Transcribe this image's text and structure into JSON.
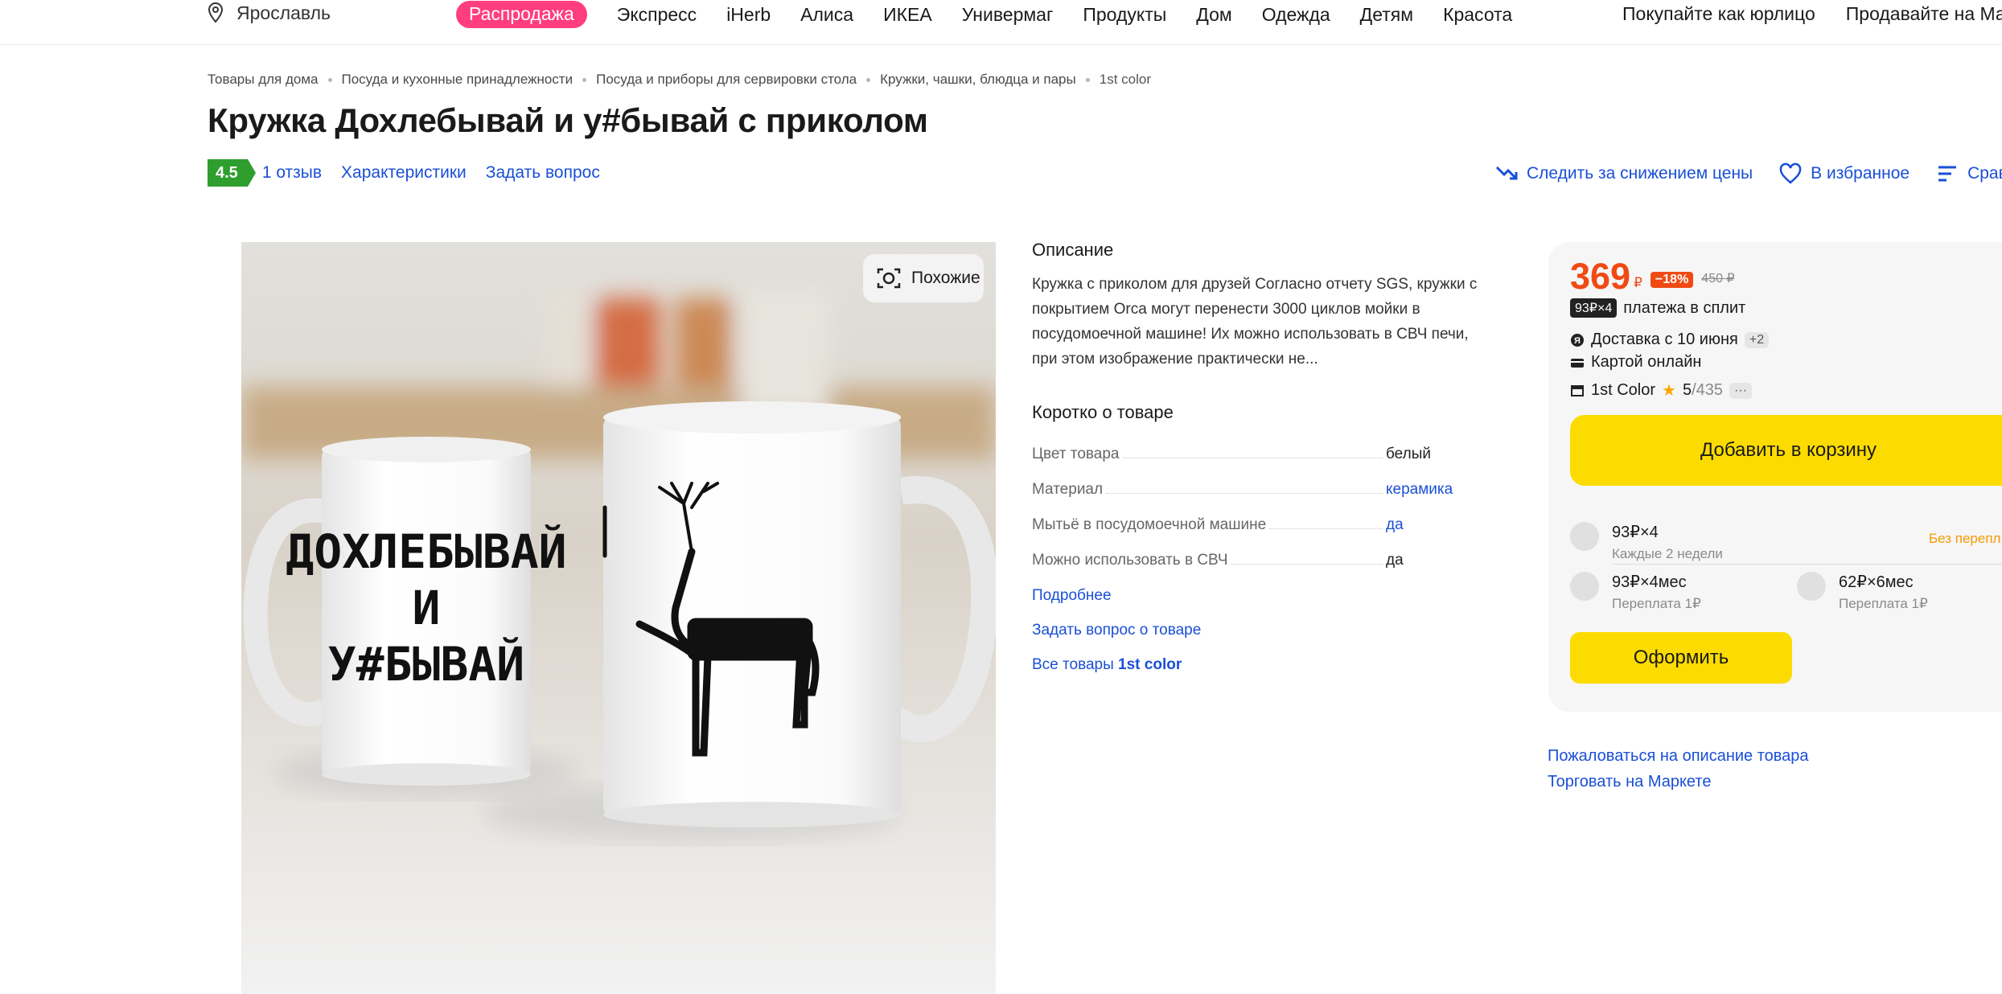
{
  "nav": {
    "location": "Ярославль",
    "sale": "Распродажа",
    "items": [
      "Экспресс",
      "iHerb",
      "Алиса",
      "ИКЕА",
      "Универмаг",
      "Продукты",
      "Дом",
      "Одежда",
      "Детям",
      "Красота"
    ],
    "right": [
      "Покупайте как юрлицо",
      "Продавайте на Мар"
    ]
  },
  "breadcrumb": [
    "Товары для дома",
    "Посуда и кухонные принадлежности",
    "Посуда и приборы для сервировки стола",
    "Кружки, чашки, блюдца и пары",
    "1st color"
  ],
  "product": {
    "title": "Кружка Дохлебывай и у#бывай с приколом",
    "rating": "4.5",
    "reviews": "1 отзыв",
    "specs_link": "Характеристики",
    "ask_link": "Задать вопрос"
  },
  "actions": {
    "price_watch": "Следить за снижением цены",
    "favorite": "В избранное",
    "compare": "Срав"
  },
  "gallery": {
    "similar": "Похожие",
    "mug_text": [
      "ДОХЛЕБЫВАЙ",
      "И",
      "У#БЫВАЙ"
    ]
  },
  "description": {
    "heading": "Описание",
    "text": "Кружка с приколом для друзей Согласно отчету SGS, кружки с покрытием Orca могут перенести 3000 циклов мойки в посудомоечной машине! Их можно использовать в СВЧ печи, при этом изображение практически не..."
  },
  "short": {
    "heading": "Коротко о товаре",
    "specs": [
      {
        "k": "Цвет товара",
        "v": "белый"
      },
      {
        "k": "Материал",
        "v": "керамика"
      },
      {
        "k": "Мытьё в посудомоечной машине",
        "v": "да"
      },
      {
        "k": "Можно использовать в СВЧ",
        "v": "да"
      }
    ],
    "more": "Подробнее",
    "ask": "Задать вопрос о товаре",
    "all_prefix": "Все товары ",
    "all_brand": "1st color"
  },
  "buy": {
    "price": "369",
    "currency": "₽",
    "discount": "−18%",
    "old_price": "450 ₽",
    "split_tag": "93₽×4",
    "split_text": "платежа в сплит",
    "delivery": "Доставка с 10 июня",
    "delivery_more": "+2",
    "payment": "Картой онлайн",
    "shop": "1st Color",
    "shop_rating": "5",
    "shop_reviews": "/435",
    "shop_more": "···",
    "cart": "Добавить в корзину",
    "plan1_title": "93₽×4",
    "plan1_sub": "Каждые 2 недели",
    "no_fee": "Без перепл",
    "plan2_title": "93₽×4мес",
    "plan2_sub": "Переплата 1₽",
    "plan3_title": "62₽×6мес",
    "plan3_sub": "Переплата 1₽",
    "checkout": "Оформить"
  },
  "bottom_links": [
    "Пожаловаться на описание товара",
    "Торговать на Маркете"
  ],
  "colors": {
    "accent_blue": "#1a4fd6",
    "price_red": "#f04a14",
    "yellow": "#fcdc00",
    "rating_green": "#2e9e2e",
    "sale_pink": "#ff3d7f"
  }
}
